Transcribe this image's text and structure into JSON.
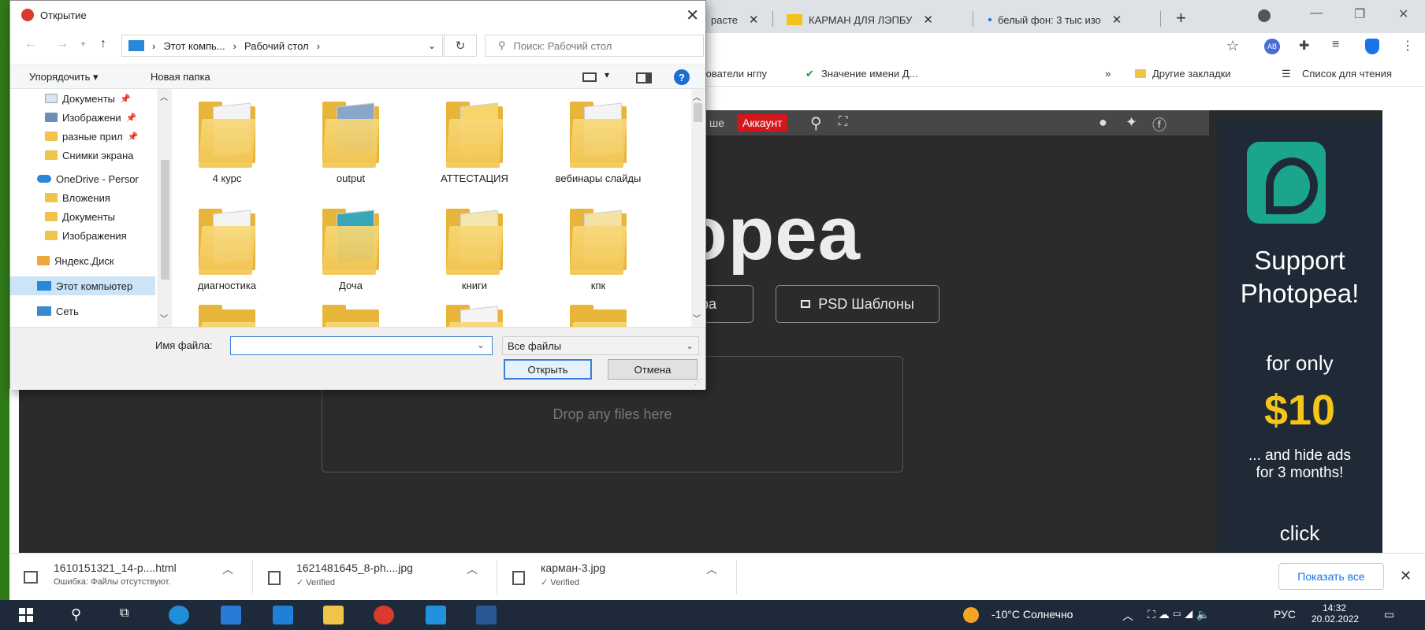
{
  "browser": {
    "tabs": [
      {
        "label": "расте",
        "close": "✕"
      },
      {
        "label": "КАРМАН ДЛЯ ЛЭПБУ",
        "close": "✕"
      },
      {
        "label": "белый фон: 3 тыс изо",
        "close": "✕"
      }
    ],
    "new_tab": "+",
    "bookmarks": [
      {
        "label": "дователи нгпу"
      },
      {
        "label": "Значение имени Д..."
      },
      {
        "label": "»"
      },
      {
        "label": "Другие закладки"
      },
      {
        "label": "Список для чтения"
      }
    ],
    "ext_badge": "AB"
  },
  "photopea": {
    "topbar_more": "ше",
    "account": "Аккаунт",
    "logo_text": "opea",
    "button_partial": "тера",
    "psd_templates": "PSD Шаблоны",
    "dropzone": "Drop any files here"
  },
  "ad": {
    "line1": "Support",
    "line2": "Photopea!",
    "for_only": "for only",
    "price": "$10",
    "hide_ads_1": "... and hide ads",
    "hide_ads_2": "for 3 months!",
    "click": "click"
  },
  "dialog": {
    "title": "Открытие",
    "close": "✕",
    "breadcrumb": [
      "Этот компь...",
      "Рабочий стол"
    ],
    "search_placeholder": "Поиск: Рабочий стол",
    "organize": "Упорядочить ▾",
    "new_folder": "Новая папка",
    "help": "?",
    "nav_items": [
      {
        "label": "Документы",
        "pinned": true
      },
      {
        "label": "Изображени",
        "pinned": true
      },
      {
        "label": "разные прил",
        "pinned": true
      },
      {
        "label": "Снимки экрана",
        "pinned": false
      },
      {
        "label": "OneDrive - Persor",
        "pinned": false
      },
      {
        "label": "Вложения",
        "pinned": false
      },
      {
        "label": "Документы",
        "pinned": false
      },
      {
        "label": "Изображения",
        "pinned": false
      },
      {
        "label": "Яндекс.Диск",
        "pinned": false
      },
      {
        "label": "Этот компьютер",
        "pinned": false
      },
      {
        "label": "Сеть",
        "pinned": false
      }
    ],
    "folders": [
      {
        "label": "4 курс"
      },
      {
        "label": "output"
      },
      {
        "label": "АТТЕСТАЦИЯ"
      },
      {
        "label": "вебинары слайды"
      },
      {
        "label": "диагностика"
      },
      {
        "label": "Доча"
      },
      {
        "label": "книги"
      },
      {
        "label": "кпк"
      }
    ],
    "filename_label": "Имя файла:",
    "filename_value": "",
    "filetype": "Все файлы",
    "open_button": "Открыть",
    "cancel_button": "Отмена"
  },
  "downloads": {
    "items": [
      {
        "name": "1610151321_14-p....html",
        "status": "Ошибка: Файлы отсутствуют."
      },
      {
        "name": "1621481645_8-ph....jpg",
        "status": "Verified"
      },
      {
        "name": "карман-3.jpg",
        "status": "Verified"
      }
    ],
    "show_all": "Показать все",
    "close": "✕"
  },
  "taskbar": {
    "weather": "-10°C Солнечно",
    "lang": "РУС",
    "time": "14:32",
    "date": "20.02.2022"
  },
  "colors": {
    "accent_blue": "#3c7fd6",
    "account_red": "#d4171d",
    "ad_teal": "#1aa58c",
    "price_yellow": "#f5c518"
  }
}
